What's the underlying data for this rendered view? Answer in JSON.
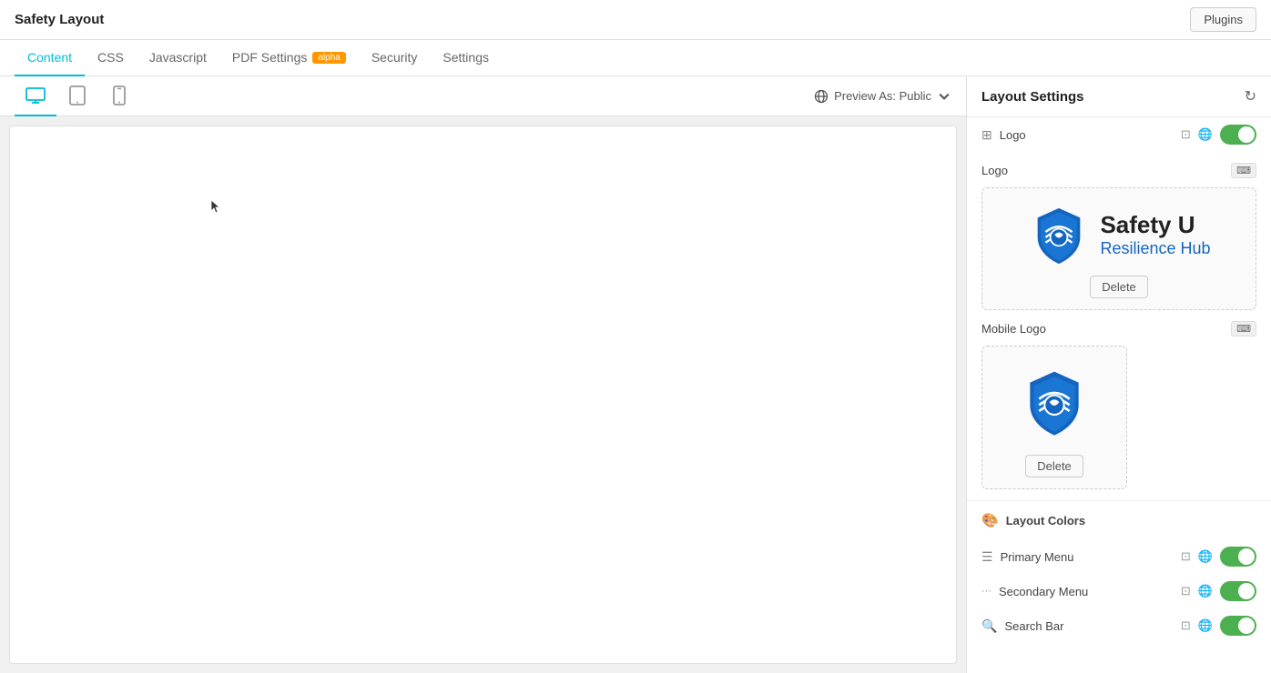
{
  "topbar": {
    "title": "Safety Layout",
    "plugins_label": "Plugins"
  },
  "tabs": [
    {
      "id": "content",
      "label": "Content",
      "active": true,
      "badge": null
    },
    {
      "id": "css",
      "label": "CSS",
      "active": false,
      "badge": null
    },
    {
      "id": "javascript",
      "label": "Javascript",
      "active": false,
      "badge": null
    },
    {
      "id": "pdf-settings",
      "label": "PDF Settings",
      "active": false,
      "badge": "alpha"
    },
    {
      "id": "security",
      "label": "Security",
      "active": false,
      "badge": null
    },
    {
      "id": "settings",
      "label": "Settings",
      "active": false,
      "badge": null
    }
  ],
  "device_toolbar": {
    "preview_label": "Preview As: Public"
  },
  "right_panel": {
    "title": "Layout Settings",
    "sections": {
      "logo": {
        "label": "Logo",
        "main_logo": {
          "label": "Logo",
          "delete_label": "Delete"
        },
        "mobile_logo": {
          "label": "Mobile Logo",
          "delete_label": "Delete"
        }
      },
      "layout_colors": {
        "label": "Layout Colors"
      },
      "primary_menu": {
        "label": "Primary Menu"
      },
      "secondary_menu": {
        "label": "Secondary Menu"
      },
      "search_bar": {
        "label": "Search Bar"
      }
    }
  },
  "safety_u": {
    "name": "Safety U",
    "sub": "Resilience Hub"
  },
  "colors": {
    "active_tab": "#00bcd4",
    "toggle_on": "#4caf50",
    "badge_alpha": "#ff9800"
  }
}
